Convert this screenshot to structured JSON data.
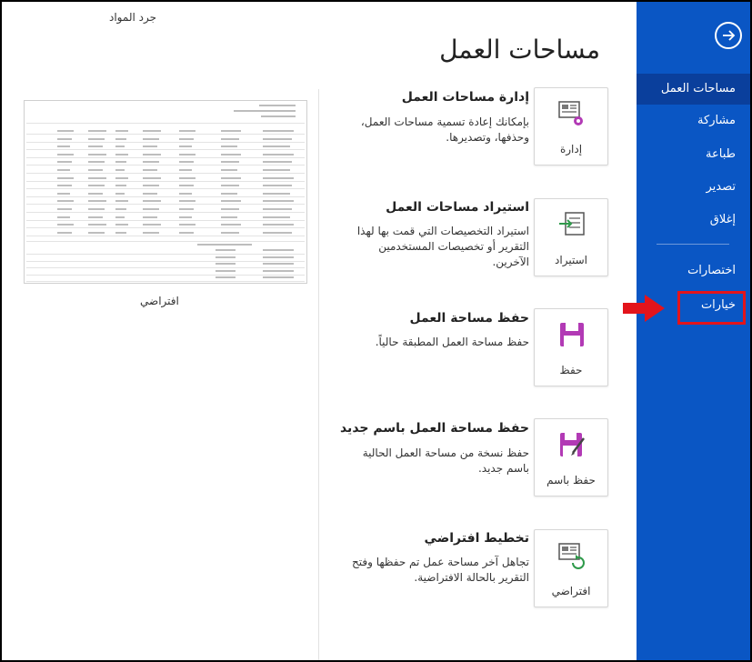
{
  "main": {
    "title": "مساحات العمل",
    "sections": [
      {
        "tile_label": "إدارة",
        "title": "إدارة مساحات العمل",
        "desc": "بإمكانك إعادة تسمية مساحات العمل، وحذفها، وتصديرها.",
        "icon": "manage-workspace-icon"
      },
      {
        "tile_label": "استيراد",
        "title": "استيراد مساحات العمل",
        "desc": "استيراد التخصيصات التي قمت بها لهذا التقرير أو تخصيصات المستخدمين الآخرين.",
        "icon": "import-icon"
      },
      {
        "tile_label": "حفظ",
        "title": "حفظ مساحة العمل",
        "desc": "حفظ مساحة العمل المطبقة حالياً.",
        "icon": "save-icon"
      },
      {
        "tile_label": "حفظ باسم",
        "title": "حفظ مساحة العمل باسم جديد",
        "desc": "حفظ نسخة من مساحة العمل الحالية باسم جديد.",
        "icon": "save-as-icon"
      },
      {
        "tile_label": "افتراضي",
        "title": "تخطيط افتراضي",
        "desc": "تجاهل آخر مساحة عمل تم حفظها وفتح التقرير بالحالة الافتراضية.",
        "icon": "reset-layout-icon"
      }
    ]
  },
  "preview": {
    "title": "جرد المواد",
    "caption": "افتراضي"
  },
  "sidebar": {
    "items": [
      {
        "label": "مساحات العمل",
        "active": true
      },
      {
        "label": "مشاركة"
      },
      {
        "label": "طباعة"
      },
      {
        "label": "تصدير"
      },
      {
        "label": "إغلاق"
      },
      {
        "label": "اختصارات"
      },
      {
        "label": "خيارات"
      }
    ]
  },
  "colors": {
    "sidebar": "#0a56c4",
    "sidebar_active": "#0a3f9c",
    "highlight": "#e3141b",
    "icon_accent": "#b23ab5"
  }
}
